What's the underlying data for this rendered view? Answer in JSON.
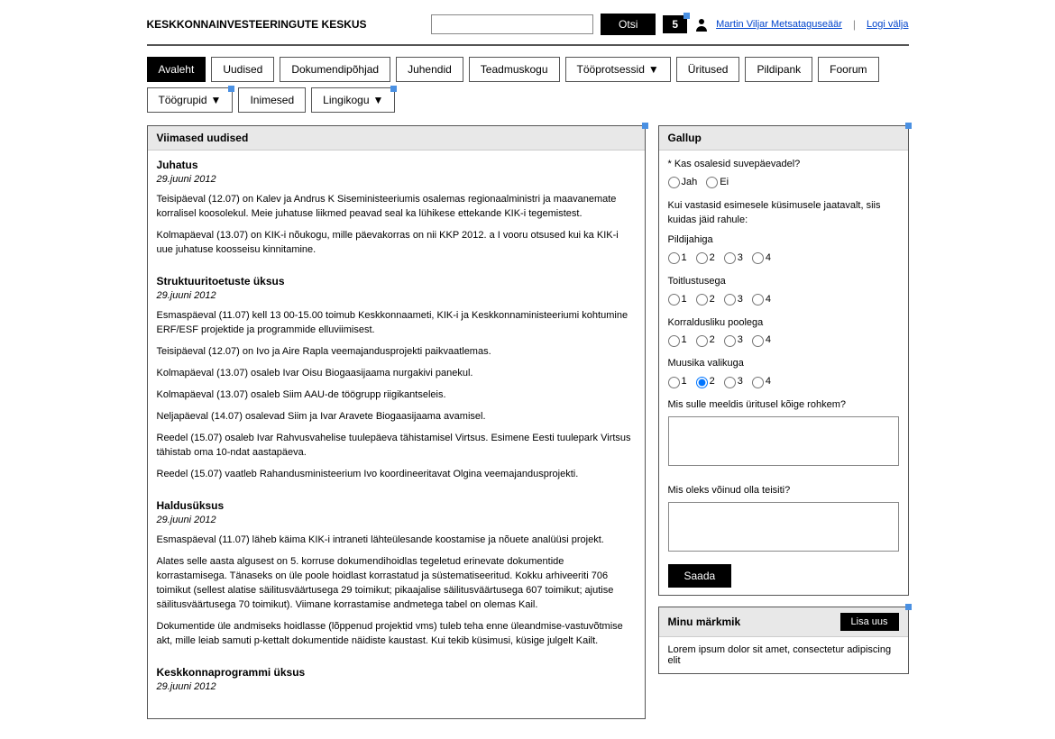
{
  "header": {
    "brand": "KESKKONNAINVESTEERINGUTE KESKUS",
    "search_placeholder": "",
    "search_btn": "Otsi",
    "notif_count": "5",
    "user_name": "Martin Viljar Metsataguseäär",
    "logout": "Logi välja"
  },
  "nav": {
    "items": [
      {
        "label": "Avaleht",
        "active": true
      },
      {
        "label": "Uudised"
      },
      {
        "label": "Dokumendipõhjad"
      },
      {
        "label": "Juhendid"
      },
      {
        "label": "Teadmuskogu"
      },
      {
        "label": "Tööprotsessid",
        "dropdown": true
      },
      {
        "label": "Üritused"
      },
      {
        "label": "Pildipank"
      },
      {
        "label": "Foorum"
      },
      {
        "label": "Töögrupid",
        "dropdown": true,
        "badge": true
      },
      {
        "label": "Inimesed"
      },
      {
        "label": "Lingikogu",
        "dropdown": true,
        "badge": true
      }
    ]
  },
  "news": {
    "title": "Viimased uudised",
    "items": [
      {
        "title": "Juhatus",
        "date": "29.juuni 2012",
        "paras": [
          "Teisipäeval (12.07) on Kalev ja Andrus K Siseministeeriumis osalemas regionaalministri ja maavanemate korralisel koosolekul. Meie juhatuse liikmed peavad seal ka lühikese ettekande KIK-i tegemistest.",
          "Kolmapäeval (13.07) on KIK-i nõukogu, mille päevakorras on nii KKP 2012. a I vooru otsused kui ka KIK-i uue juhatuse koosseisu kinnitamine."
        ]
      },
      {
        "title": "Struktuuritoetuste üksus",
        "date": "29.juuni 2012",
        "paras": [
          "Esmaspäeval (11.07) kell 13 00-15.00 toimub Keskkonnaameti, KIK-i ja Keskkonnaministeeriumi kohtumine ERF/ESF projektide ja programmide elluviimisest.",
          "Teisipäeval (12.07) on Ivo ja Aire Rapla veemajandusprojekti paikvaatlemas.",
          "Kolmapäeval (13.07) osaleb Ivar Oisu Biogaasijaama nurgakivi panekul.",
          "Kolmapäeval (13.07) osaleb Siim AAU-de töögrupp riigikantseleis.",
          "Neljapäeval (14.07) osalevad Siim ja Ivar Aravete Biogaasijaama avamisel.",
          "Reedel (15.07) osaleb Ivar Rahvusvahelise tuulepäeva tähistamisel Virtsus. Esimene Eesti tuulepark Virtsus tähistab oma 10-ndat aastapäeva.",
          "Reedel (15.07) vaatleb Rahandusministeerium Ivo koordineeritavat Olgina veemajandusprojekti."
        ]
      },
      {
        "title": "Haldusüksus",
        "date": "29.juuni 2012",
        "paras": [
          "Esmaspäeval (11.07) läheb käima KIK-i intraneti lähteülesande koostamise ja nõuete analüüsi projekt.",
          "Alates selle aasta algusest on 5. korruse dokumendihoidlas tegeletud erinevate dokumentide korrastamisega.\nTänaseks on üle poole hoidlast korrastatud ja süstematiseeritud.\nKokku arhiveeriti 706 toimikut (sellest alatise säilitusväärtusega 29 toimikut; pikaajalise säilitusväärtusega 607 toimikut; ajutise säilitusväärtusega 70 toimikut). Viimane korrastamise andmetega tabel on olemas Kail.",
          "Dokumentide üle andmiseks hoidlasse (lõppenud projektid vms) tuleb teha enne üleandmise-vastuvõtmise akt, mille leiab samuti p-kettalt dokumentide näidiste kaustast. Kui tekib küsimusi, küsige julgelt Kailt."
        ]
      },
      {
        "title": "Keskkonnaprogrammi üksus",
        "date": "29.juuni 2012",
        "paras": []
      }
    ]
  },
  "poll": {
    "title": "Gallup",
    "q1": "* Kas osalesid suvepäevadel?",
    "opt_yes": "Jah",
    "opt_no": "Ei",
    "intro": "Kui vastasid esimesele küsimusele jaatavalt, siis kuidas jäid rahule:",
    "cat1": "Pildijahiga",
    "cat2": "Toitlustusega",
    "cat3": "Korraldusliku poolega",
    "cat4": "Muusika valikuga",
    "r1": "1",
    "r2": "2",
    "r3": "3",
    "r4": "4",
    "q_like": "Mis sulle meeldis üritusel kõige rohkem?",
    "q_diff": "Mis oleks võinud olla teisiti?",
    "submit": "Saada"
  },
  "notes": {
    "title": "Minu märkmik",
    "add_btn": "Lisa uus",
    "lorem": "Lorem ipsum dolor sit amet, consectetur adipiscing elit"
  }
}
